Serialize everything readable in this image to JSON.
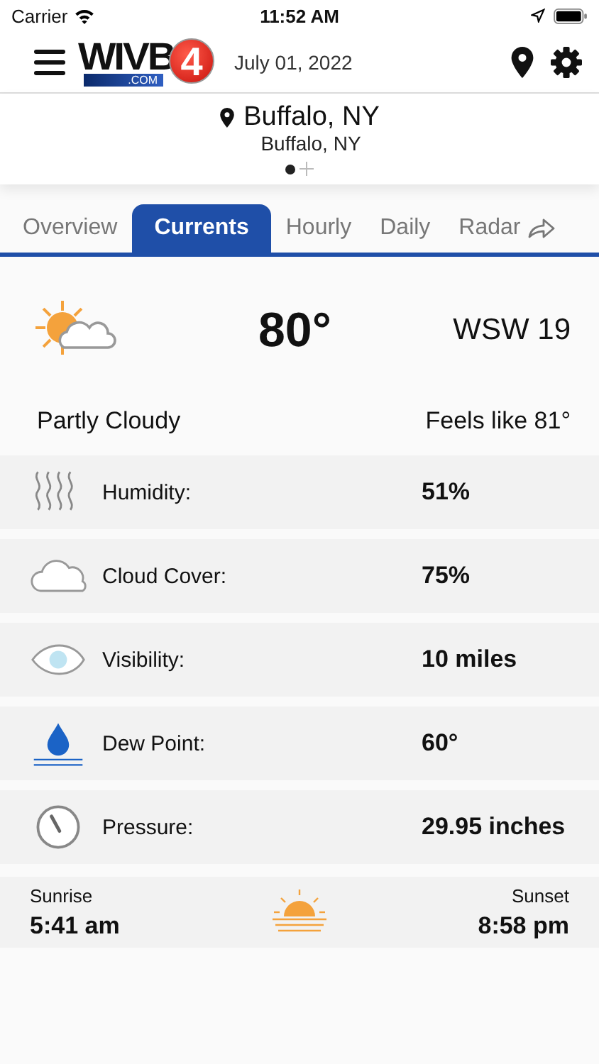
{
  "status_bar": {
    "carrier": "Carrier",
    "time": "11:52 AM"
  },
  "header": {
    "logo": {
      "letters": "WIVB",
      "number": "4",
      "domain": ".COM"
    },
    "date": "July 01, 2022"
  },
  "location": {
    "name": "Buffalo, NY",
    "subtitle": "Buffalo, NY",
    "pages": [
      {
        "selected": true
      }
    ]
  },
  "tabs": [
    {
      "label": "Overview",
      "selected": false
    },
    {
      "label": "Currents",
      "selected": true
    },
    {
      "label": "Hourly",
      "selected": false
    },
    {
      "label": "Daily",
      "selected": false
    },
    {
      "label": "Radar",
      "selected": false,
      "external": true
    }
  ],
  "current": {
    "temperature": "80°",
    "wind": "WSW 19",
    "condition": "Partly Cloudy",
    "feels_like": "Feels like 81°"
  },
  "details": [
    {
      "kind": "humidity",
      "label": "Humidity:",
      "value": "51%"
    },
    {
      "kind": "cloud",
      "label": "Cloud Cover:",
      "value": "75%"
    },
    {
      "kind": "visibility",
      "label": "Visibility:",
      "value": "10 miles"
    },
    {
      "kind": "dew",
      "label": "Dew Point:",
      "value": "60°"
    },
    {
      "kind": "pressure",
      "label": "Pressure:",
      "value": "29.95 inches"
    }
  ],
  "sun": {
    "sunrise_label": "Sunrise",
    "sunrise": "5:41 am",
    "sunset_label": "Sunset",
    "sunset": "8:58 pm"
  }
}
